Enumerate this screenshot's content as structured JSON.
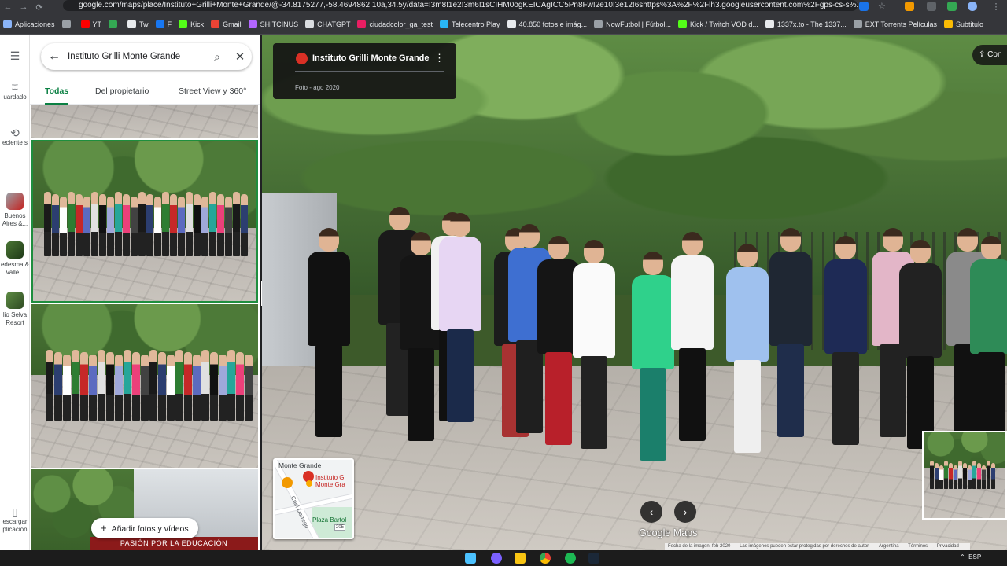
{
  "browser": {
    "url": "google.com/maps/place/Instituto+Grilli+Monte+Grande/@-34.8175277,-58.4694862,10a,34.5y/data=!3m8!1e2!3m6!1sCIHM0ogKEICAgICC5Pn8Fw!2e10!3e12!6shttps%3A%2F%2Flh3.googleusercontent.com%2Fgps-cs-s%2F..."
  },
  "bookmarks": [
    {
      "label": "Aplicaciones",
      "color": "#8ab4f8"
    },
    {
      "label": "",
      "color": "#9aa0a6"
    },
    {
      "label": "YT",
      "color": "#ff0000"
    },
    {
      "label": "",
      "color": "#34a853"
    },
    {
      "label": "Tw",
      "color": "#e8eaed"
    },
    {
      "label": "F",
      "color": "#1877f2"
    },
    {
      "label": "Kick",
      "color": "#53fc18"
    },
    {
      "label": "Gmail",
      "color": "#ea4335"
    },
    {
      "label": "SHITCINUS",
      "color": "#b366ff"
    },
    {
      "label": "CHATGPT",
      "color": "#dadce0"
    },
    {
      "label": "ciudadcolor_ga_test",
      "color": "#e91e63"
    },
    {
      "label": "Telecentro Play",
      "color": "#29b6f6"
    },
    {
      "label": "40.850 fotos e imág...",
      "color": "#e8eaed"
    },
    {
      "label": "NowFutbol | Fútbol...",
      "color": "#9aa0a6"
    },
    {
      "label": "Kick / Twitch VOD d...",
      "color": "#53fc18"
    },
    {
      "label": "1337x.to - The 1337...",
      "color": "#e8eaed"
    },
    {
      "label": "EXT Torrents Películas",
      "color": "#9aa0a6"
    },
    {
      "label": "Subtitulo",
      "color": "#fbbc04"
    }
  ],
  "rail": {
    "menu_icon": "menu-icon",
    "items": [
      {
        "label": "uardado",
        "icon": "bookmark-icon"
      },
      {
        "label": "eciente s",
        "icon": "history-icon"
      },
      {
        "label": "Buenos Aires &...",
        "icon": "place-thumb"
      },
      {
        "label": "edesma & Valle...",
        "icon": "place-thumb"
      },
      {
        "label": "lio Selva Resort",
        "icon": "place-thumb"
      },
      {
        "label": "escargar plicación",
        "icon": "phone-icon"
      }
    ]
  },
  "panel": {
    "search_value": "Instituto Grilli Monte Grande",
    "tabs": [
      {
        "label": "Todas",
        "active": true
      },
      {
        "label": "Del propietario",
        "active": false
      },
      {
        "label": "Street View y 360°",
        "active": false
      }
    ],
    "add_photos_label": "Añadir fotos y vídeos",
    "banner_text": "PASIÓN POR LA EDUCACIÓN"
  },
  "viewer": {
    "place_title": "Instituto Grilli Monte Grande",
    "photo_meta": "Foto - ago 2020",
    "share_label": "Con",
    "minimap": {
      "area_label": "Monte Grande",
      "place_label": "Instituto G Monte Gra",
      "street_label": "Cnel Dorrego",
      "plaza_label": "Plaza Bartol",
      "route_badge": "205"
    },
    "logo_text": "Google Maps",
    "attribution": {
      "date": "Fecha de la imagen: feb 2020",
      "rights": "Las imágenes pueden estar protegidas por derechos de autor.",
      "country": "Argentina",
      "terms": "Términos",
      "privacy": "Privacidad"
    }
  },
  "taskbar": {
    "tray_lang": "ESP"
  }
}
